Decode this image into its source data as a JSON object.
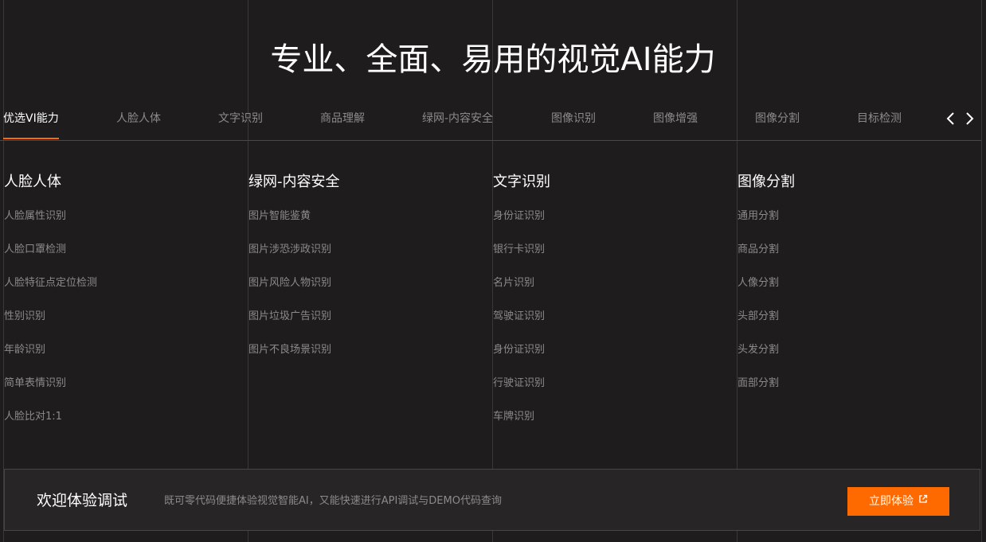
{
  "page_title": "专业、全面、易用的视觉AI能力",
  "tabs": [
    {
      "label": "优选VI能力",
      "active": true
    },
    {
      "label": "人脸人体",
      "active": false
    },
    {
      "label": "文字识别",
      "active": false
    },
    {
      "label": "商品理解",
      "active": false
    },
    {
      "label": "绿网-内容安全",
      "active": false
    },
    {
      "label": "图像识别",
      "active": false
    },
    {
      "label": "图像增强",
      "active": false
    },
    {
      "label": "图像分割",
      "active": false
    },
    {
      "label": "目标检测",
      "active": false
    }
  ],
  "nav_icons": {
    "prev": "chevron-left-icon",
    "next": "chevron-right-icon"
  },
  "columns": [
    {
      "title": "人脸人体",
      "items": [
        "人脸属性识别",
        "人脸口罩检测",
        "人脸特征点定位检测",
        "性别识别",
        "年龄识别",
        "简单表情识别",
        "人脸比对1:1"
      ]
    },
    {
      "title": "绿网-内容安全",
      "items": [
        "图片智能鉴黄",
        "图片涉恐涉政识别",
        "图片风险人物识别",
        "图片垃圾广告识别",
        "图片不良场景识别"
      ]
    },
    {
      "title": "文字识别",
      "items": [
        "身份证识别",
        "银行卡识别",
        "名片识别",
        "驾驶证识别",
        "身份证识别",
        "行驶证识别",
        "车牌识别"
      ]
    },
    {
      "title": "图像分割",
      "items": [
        "通用分割",
        "商品分割",
        "人像分割",
        "头部分割",
        "头发分割",
        "面部分割"
      ]
    }
  ],
  "banner": {
    "title": "欢迎体验调试",
    "description": "既可零代码便捷体验视觉智能AI，又能快速进行API调试与DEMO代码查询",
    "cta_label": "立即体验",
    "cta_icon": "external-link-icon"
  },
  "colors": {
    "background": "#1e1c1d",
    "accent": "#ff6a00",
    "muted_text": "#8c8a8b"
  }
}
